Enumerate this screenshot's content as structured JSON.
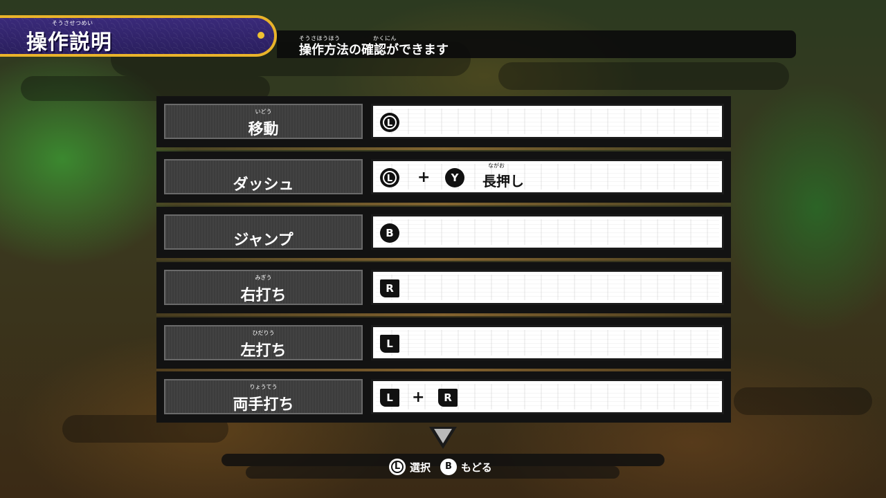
{
  "header": {
    "title": "操作説明",
    "title_ruby": "そうさせつめい",
    "subtitle": "操作方法の確認ができます",
    "subtitle_ruby_1": "そうさほうほう",
    "subtitle_ruby_2": "かくにん"
  },
  "controls": [
    {
      "label": "移動",
      "ruby": "いどう"
    },
    {
      "label": "ダッシュ",
      "ruby": ""
    },
    {
      "label": "ジャンプ",
      "ruby": ""
    },
    {
      "label": "右打ち",
      "ruby": "みぎう"
    },
    {
      "label": "左打ち",
      "ruby": "ひだりう"
    },
    {
      "label": "両手打ち",
      "ruby": "りょうてう"
    }
  ],
  "buttons": {
    "L": "L",
    "Y": "Y",
    "B": "B",
    "R": "R",
    "plus": "+",
    "hold": "長押し",
    "hold_ruby": "ながお"
  },
  "footer": {
    "select_button": "L",
    "select_label": "選択",
    "back_button": "B",
    "back_label": "もどる"
  },
  "colors": {
    "title_bg": "#2a1f5e",
    "title_border": "#e9b32a",
    "label_bg": "#3c3c3c",
    "value_bg": "#ffffff"
  }
}
